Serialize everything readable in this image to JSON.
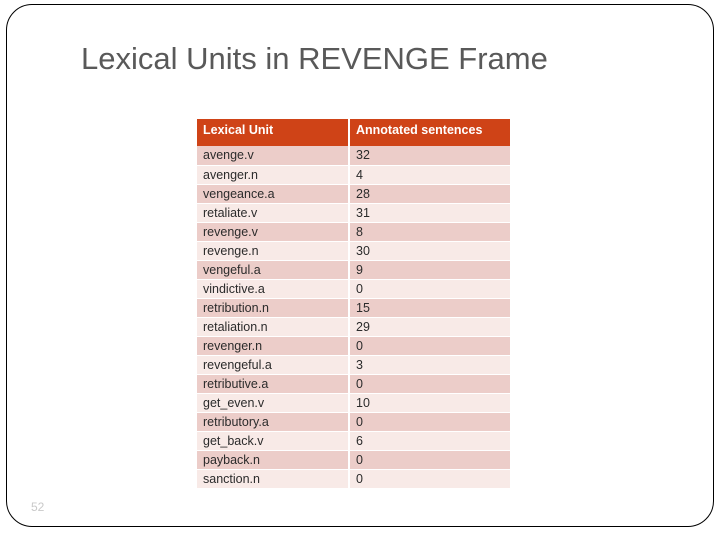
{
  "slide": {
    "title": "Lexical Units in REVENGE Frame",
    "page_number": "52",
    "accent_color": "#cf4317",
    "title_color": "#595959",
    "row_color_odd": "#eccdc9",
    "row_color_even": "#f8eae7"
  },
  "table": {
    "columns": [
      "Lexical Unit",
      "Annotated sentences"
    ],
    "rows": [
      {
        "unit": "avenge.v",
        "count": "32"
      },
      {
        "unit": "avenger.n",
        "count": "4"
      },
      {
        "unit": "vengeance.a",
        "count": "28"
      },
      {
        "unit": "retaliate.v",
        "count": "31"
      },
      {
        "unit": "revenge.v",
        "count": "8"
      },
      {
        "unit": "revenge.n",
        "count": "30"
      },
      {
        "unit": "vengeful.a",
        "count": "9"
      },
      {
        "unit": "vindictive.a",
        "count": "0"
      },
      {
        "unit": "retribution.n",
        "count": "15"
      },
      {
        "unit": "retaliation.n",
        "count": "29"
      },
      {
        "unit": "revenger.n",
        "count": "0"
      },
      {
        "unit": "revengeful.a",
        "count": "3"
      },
      {
        "unit": "retributive.a",
        "count": "0"
      },
      {
        "unit": "get_even.v",
        "count": "10"
      },
      {
        "unit": "retributory.a",
        "count": "0"
      },
      {
        "unit": "get_back.v",
        "count": "6"
      },
      {
        "unit": "payback.n",
        "count": "0"
      },
      {
        "unit": "sanction.n",
        "count": "0"
      }
    ]
  }
}
